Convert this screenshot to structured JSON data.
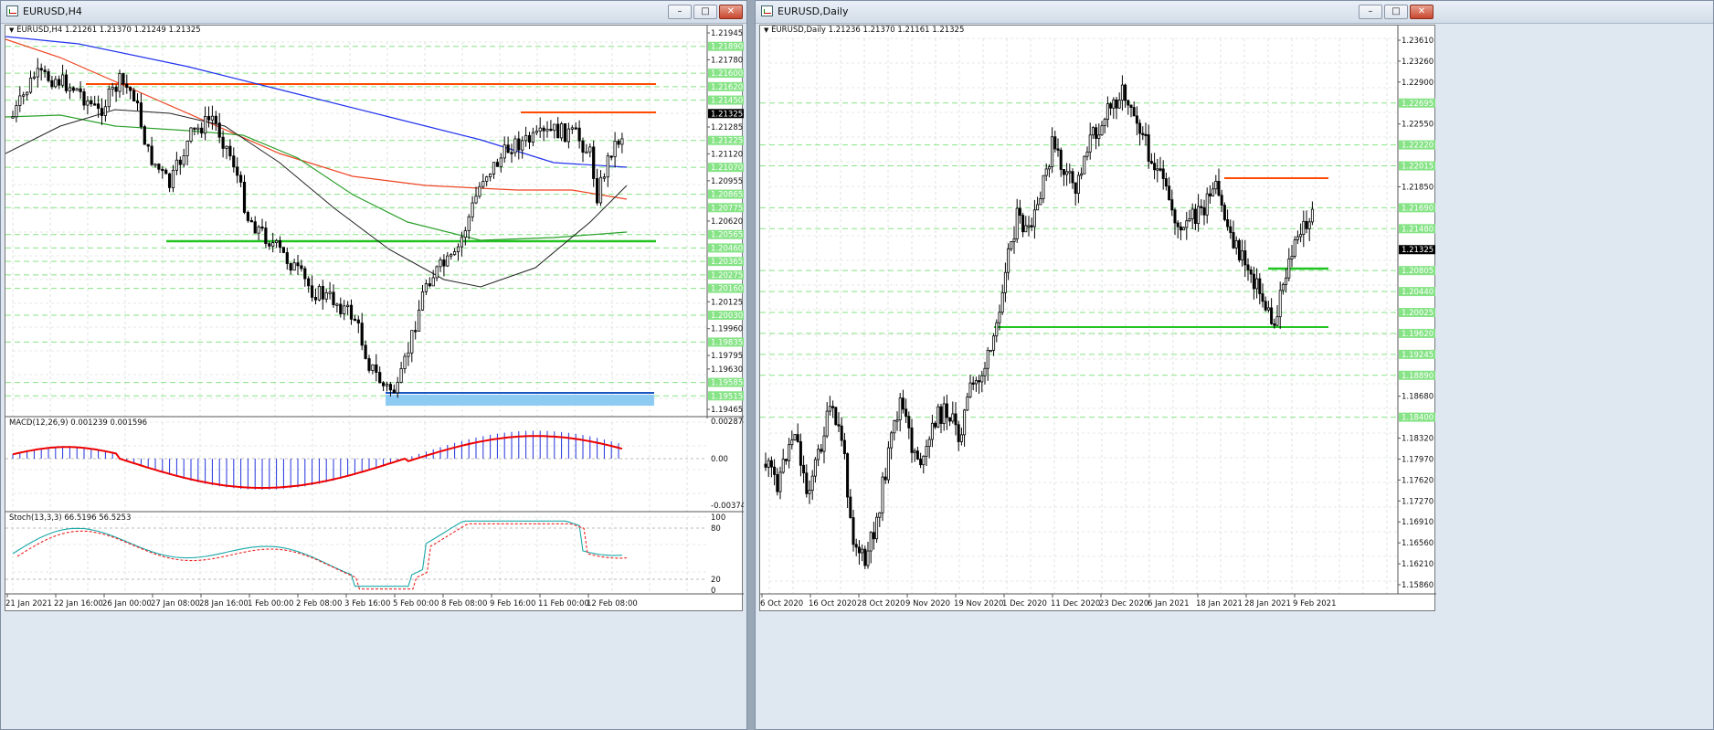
{
  "left_window": {
    "title": "EURUSD,H4",
    "info": "EURUSD,H4  1.21261 1.21370 1.21249 1.21325",
    "buttons": {
      "minimize": "–",
      "maximize": "□",
      "close": "✕"
    },
    "price_scale": [
      {
        "v": "1.21945"
      },
      {
        "v": "1.21890",
        "hl": true
      },
      {
        "v": "1.21780"
      },
      {
        "v": "1.21600",
        "hl": true
      },
      {
        "v": "1.21620",
        "hl": true
      },
      {
        "v": "1.21450",
        "hl": true
      },
      {
        "v": "1.21325",
        "cur": true
      },
      {
        "v": "1.21285"
      },
      {
        "v": "1.21225",
        "hl": true
      },
      {
        "v": "1.21120"
      },
      {
        "v": "1.21070",
        "hl": true
      },
      {
        "v": "1.20955"
      },
      {
        "v": "1.20865",
        "hl": true
      },
      {
        "v": "1.20775",
        "hl": true
      },
      {
        "v": "1.20620"
      },
      {
        "v": "1.20565",
        "hl": true
      },
      {
        "v": "1.20460",
        "hl": true
      },
      {
        "v": "1.20365",
        "hl": true
      },
      {
        "v": "1.20275",
        "hl": true
      },
      {
        "v": "1.20160",
        "hl": true
      },
      {
        "v": "1.20125"
      },
      {
        "v": "1.20030",
        "hl": true
      },
      {
        "v": "1.19960"
      },
      {
        "v": "1.19835",
        "hl": true
      },
      {
        "v": "1.19795"
      },
      {
        "v": "1.19630"
      },
      {
        "v": "1.19585",
        "hl": true
      },
      {
        "v": "1.19515",
        "hl": true
      },
      {
        "v": "1.19465"
      }
    ],
    "time_labels": [
      "21 Jan 2021",
      "22 Jan 16:00",
      "26 Jan 00:00",
      "27 Jan 08:00",
      "28 Jan 16:00",
      "1 Feb 00:00",
      "2 Feb 08:00",
      "3 Feb 16:00",
      "5 Feb 00:00",
      "8 Feb 08:00",
      "9 Feb 16:00",
      "11 Feb 00:00",
      "12 Feb 08:00"
    ],
    "macd": {
      "label": "MACD(12,26,9) 0.001239 0.001596",
      "scale": [
        "0.002874",
        "0.00",
        "-0.003742"
      ]
    },
    "stoch": {
      "label": "Stoch(13,3,3) 66.5196 56.5253",
      "scale": [
        "100",
        "80",
        "20",
        "0"
      ]
    }
  },
  "right_window": {
    "title": "EURUSD,Daily",
    "info": "EURUSD,Daily  1.21236 1.21370 1.21161 1.21325",
    "buttons": {
      "minimize": "–",
      "maximize": "□",
      "close": "✕"
    },
    "price_scale": [
      {
        "v": "1.23610"
      },
      {
        "v": "1.23260"
      },
      {
        "v": "1.22900"
      },
      {
        "v": "1.22695",
        "hl": true
      },
      {
        "v": "1.22550"
      },
      {
        "v": "1.22220",
        "hl": true
      },
      {
        "v": "1.22015",
        "hl": true
      },
      {
        "v": "1.21850"
      },
      {
        "v": "1.21690",
        "hl": true
      },
      {
        "v": "1.21480",
        "hl": true
      },
      {
        "v": "1.21325",
        "cur": true
      },
      {
        "v": "1.20805",
        "hl": true
      },
      {
        "v": "1.20440",
        "hl": true
      },
      {
        "v": "1.20025",
        "hl": true
      },
      {
        "v": "1.19620",
        "hl": true
      },
      {
        "v": "1.19245",
        "hl": true
      },
      {
        "v": "1.18890",
        "hl": true
      },
      {
        "v": "1.18680"
      },
      {
        "v": "1.18400",
        "hl": true
      },
      {
        "v": "1.18320"
      },
      {
        "v": "1.17970"
      },
      {
        "v": "1.17620"
      },
      {
        "v": "1.17270"
      },
      {
        "v": "1.16910"
      },
      {
        "v": "1.16560"
      },
      {
        "v": "1.16210"
      },
      {
        "v": "1.15860"
      }
    ],
    "time_labels": [
      "6 Oct 2020",
      "16 Oct 2020",
      "28 Oct 2020",
      "9 Nov 2020",
      "19 Nov 2020",
      "1 Dec 2020",
      "11 Dec 2020",
      "23 Dec 2020",
      "6 Jan 2021",
      "18 Jan 2021",
      "28 Jan 2021",
      "9 Feb 2021"
    ]
  },
  "colors": {
    "bull": "#ffffff",
    "bear": "#000000",
    "resistance": "#ff4a00",
    "support": "#22c422",
    "sma_blue": "#2233ee",
    "sma_red": "#ee4422",
    "macd_hist": "#2233dd",
    "macd_signal": "#ee0000",
    "stoch_main": "#1aa8a8",
    "stoch_signal": "#ee2222",
    "demand_zone": "#8ecbf2",
    "level_green": "#86e386"
  }
}
